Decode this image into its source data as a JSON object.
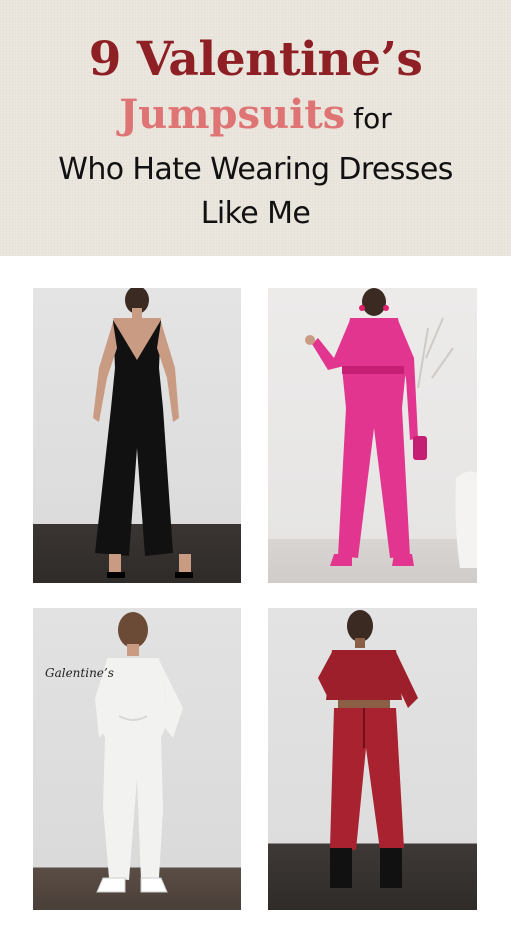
{
  "title": {
    "line1": "9 Valentine’s",
    "line2_highlight": "Jumpsuits",
    "line2_rest": "for",
    "line3": "Who Hate Wearing Dresses",
    "line4": "Like Me"
  },
  "photos": [
    {
      "icon": "black-satin-jumpsuit",
      "caption": ""
    },
    {
      "icon": "pink-belted-jumpsuit",
      "caption": ""
    },
    {
      "icon": "white-knit-jumpsuit",
      "caption": "Galentine’s"
    },
    {
      "icon": "red-leather-jumpsuit",
      "caption": ""
    }
  ],
  "colors": {
    "title_dark_red": "#8e1f24",
    "title_pink": "#df7474",
    "header_bg": "#ece7de"
  }
}
